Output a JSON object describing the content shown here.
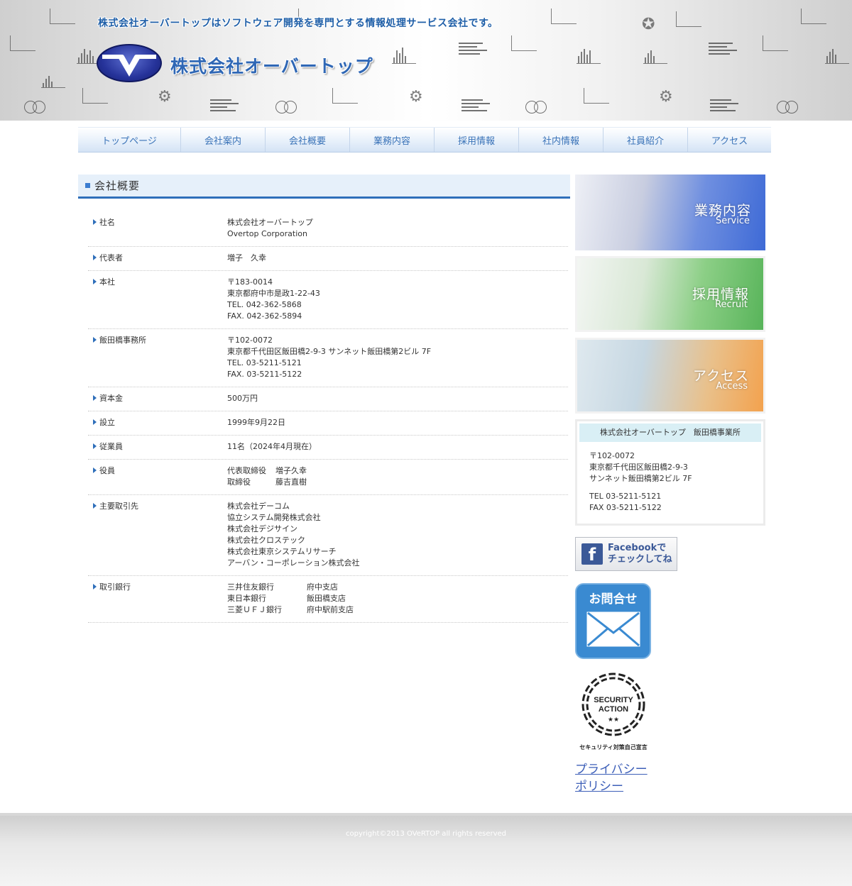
{
  "header": {
    "tagline": "株式会社オーバートップはソフトウェア開発を専門とする情報処理サービス会社です。",
    "company_logo_text": "株式会社オーバートップ"
  },
  "nav": [
    "トップページ",
    "会社案内",
    "会社概要",
    "業務内容",
    "採用情報",
    "社内情報",
    "社員紹介",
    "アクセス"
  ],
  "main": {
    "section_title": "会社概要",
    "rows": [
      {
        "key": "社名",
        "lines": [
          "株式会社オーバートップ",
          "Overtop Corporation"
        ]
      },
      {
        "key": "代表者",
        "lines": [
          "増子　久幸"
        ]
      },
      {
        "key": "本社",
        "lines": [
          "〒183-0014",
          "東京都府中市是政1-22-43",
          "TEL. 042-362-5868",
          "FAX. 042-362-5894"
        ]
      },
      {
        "key": "飯田橋事務所",
        "lines": [
          "〒102-0072",
          "東京都千代田区飯田橋2-9-3 サンネット飯田橋第2ビル 7F",
          "TEL. 03-5211-5121",
          "FAX. 03-5211-5122"
        ]
      },
      {
        "key": "資本金",
        "lines": [
          "500万円"
        ]
      },
      {
        "key": "設立",
        "lines": [
          "1999年9月22日"
        ]
      },
      {
        "key": "従業員",
        "lines": [
          "11名（2024年4月現在）"
        ]
      }
    ],
    "officers": {
      "key": "役員",
      "rows": [
        {
          "role": "代表取締役",
          "name": "増子久幸"
        },
        {
          "role": "取締役",
          "name": "藤吉直樹"
        }
      ]
    },
    "clients": {
      "key": "主要取引先",
      "lines": [
        "株式会社デーコム",
        "協立システム開発株式会社",
        "株式会社デジサイン",
        "株式会社クロステック",
        "株式会社東京システムリサーチ",
        "アーバン・コーポレーション株式会社"
      ]
    },
    "banks": {
      "key": "取引銀行",
      "rows": [
        {
          "bank": "三井住友銀行",
          "branch": "府中支店"
        },
        {
          "bank": "東日本銀行",
          "branch": "飯田橋支店"
        },
        {
          "bank": "三菱ＵＦＪ銀行",
          "branch": "府中駅前支店"
        }
      ]
    }
  },
  "sidebar": {
    "banners": [
      {
        "jp": "業務内容",
        "en": "Service"
      },
      {
        "jp": "採用情報",
        "en": "Recruit"
      },
      {
        "jp": "アクセス",
        "en": "Access"
      }
    ],
    "office": {
      "title": "株式会社オーバートップ　飯田橋事業所",
      "postal": "〒102-0072",
      "addr1": "東京都千代田区飯田橋2-9-3",
      "addr2": "サンネット飯田橋第2ビル 7F",
      "tel": "TEL 03-5211-5121",
      "fax": "FAX 03-5211-5122"
    },
    "facebook": {
      "line1": "Facebookで",
      "line2": "チェックしてね"
    },
    "contact_label": "お問合せ",
    "security": {
      "line1": "SECURITY",
      "line2": "ACTION",
      "stars": "★★",
      "caption": "セキュリティ対策自己宣言"
    },
    "privacy_line1": "プライバシー",
    "privacy_line2": "ポリシー"
  },
  "footer": {
    "copyright": "copyright©2013 OVeRTOP all rights reserved"
  }
}
